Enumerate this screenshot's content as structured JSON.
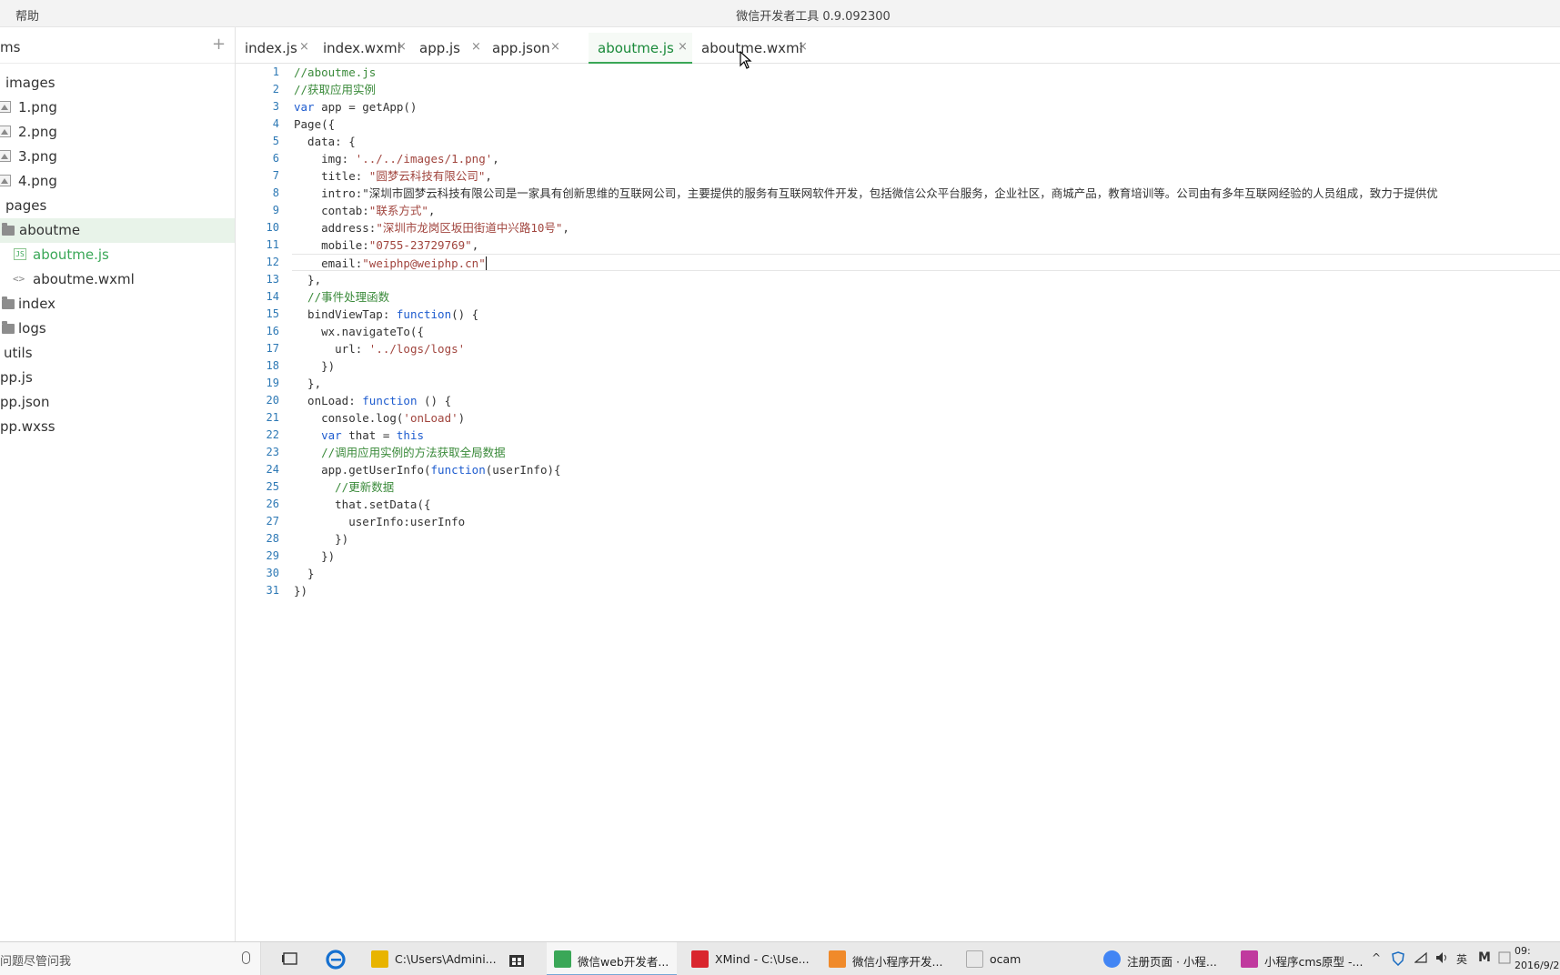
{
  "titlebar": {
    "menu_help": "帮助",
    "title": "微信开发者工具 0.9.092300"
  },
  "sidebar": {
    "project_name": "ms",
    "add_symbol": "+",
    "items": [
      {
        "label": "images",
        "kind": "folder-open"
      },
      {
        "label": "1.png",
        "kind": "image"
      },
      {
        "label": "2.png",
        "kind": "image"
      },
      {
        "label": "3.png",
        "kind": "image"
      },
      {
        "label": "4.png",
        "kind": "image"
      },
      {
        "label": "pages",
        "kind": "folder-open"
      },
      {
        "label": "aboutme",
        "kind": "folder"
      },
      {
        "label": "aboutme.js",
        "kind": "js",
        "selected": true
      },
      {
        "label": "aboutme.wxml",
        "kind": "code"
      },
      {
        "label": "index",
        "kind": "folder"
      },
      {
        "label": "logs",
        "kind": "folder"
      },
      {
        "label": "utils",
        "kind": "folder-open"
      },
      {
        "label": "pp.js",
        "kind": "file"
      },
      {
        "label": "pp.json",
        "kind": "file"
      },
      {
        "label": "pp.wxss",
        "kind": "file"
      }
    ]
  },
  "tabs": [
    {
      "label": "index.js",
      "close": "×"
    },
    {
      "label": "index.wxml",
      "close": "×"
    },
    {
      "label": "app.js",
      "close": "×"
    },
    {
      "label": "app.json",
      "close": "×"
    },
    {
      "label": "aboutme.js",
      "close": "×",
      "active": true
    },
    {
      "label": "aboutme.wxml",
      "close": "×"
    }
  ],
  "editor": {
    "line_numbers": [
      "1",
      "2",
      "3",
      "4",
      "5",
      "6",
      "7",
      "8",
      "9",
      "10",
      "11",
      "12",
      "13",
      "14",
      "15",
      "16",
      "17",
      "18",
      "19",
      "20",
      "21",
      "22",
      "23",
      "24",
      "25",
      "26",
      "27",
      "28",
      "29",
      "30",
      "31"
    ],
    "lines": [
      "//aboutme.js",
      "//获取应用实例",
      "var app = getApp()",
      "Page({",
      "  data: {",
      "    img: '../../images/1.png',",
      "    title: \"圆梦云科技有限公司\",",
      "    intro:\"深圳市圆梦云科技有限公司是一家具有创新思维的互联网公司，主要提供的服务有互联网软件开发，包括微信公众平台服务，企业社区，商城产品，教育培训等。公司由有多年互联网经验的人员组成，致力于提供优",
      "    contab:\"联系方式\",",
      "    address:\"深圳市龙岗区坂田街道中兴路10号\",",
      "    mobile:\"0755-23729769\",",
      "    email:\"weiphp@weiphp.cn\"",
      "  },",
      "  //事件处理函数",
      "  bindViewTap: function() {",
      "    wx.navigateTo({",
      "      url: '../logs/logs'",
      "    })",
      "  },",
      "  onLoad: function () {",
      "    console.log('onLoad')",
      "    var that = this",
      "    //调用应用实例的方法获取全局数据",
      "    app.getUserInfo(function(userInfo){",
      "      //更新数据",
      "      that.setData({",
      "        userInfo:userInfo",
      "      })",
      "    })",
      "  }",
      "})"
    ]
  },
  "taskbar": {
    "search_placeholder": "问题尽管问我",
    "tasks": [
      {
        "label": "C:\\Users\\Admini...",
        "color": "#e8b400"
      },
      {
        "label": "微信web开发者...",
        "color": "#3aa757",
        "active": true
      },
      {
        "label": "XMind - C:\\Use...",
        "color": "#d9262e"
      },
      {
        "label": "微信小程序开发...",
        "color": "#f08a2a"
      },
      {
        "label": "ocam",
        "color": "#e8e8e8"
      },
      {
        "label": "注册页面 · 小程...",
        "color": "#4285f4"
      },
      {
        "label": "小程序cms原型 -...",
        "color": "#c0399e"
      }
    ],
    "tray_lang": "英",
    "tray_m": "M",
    "clock_time": "09:",
    "clock_date": "2016/9/2"
  },
  "colors": {
    "accent_green": "#3aa757",
    "line_number_blue": "#2e79b5",
    "keyword_blue": "#1e5ccf",
    "string_red": "#a1453e",
    "comment_green": "#3a8a3a"
  }
}
